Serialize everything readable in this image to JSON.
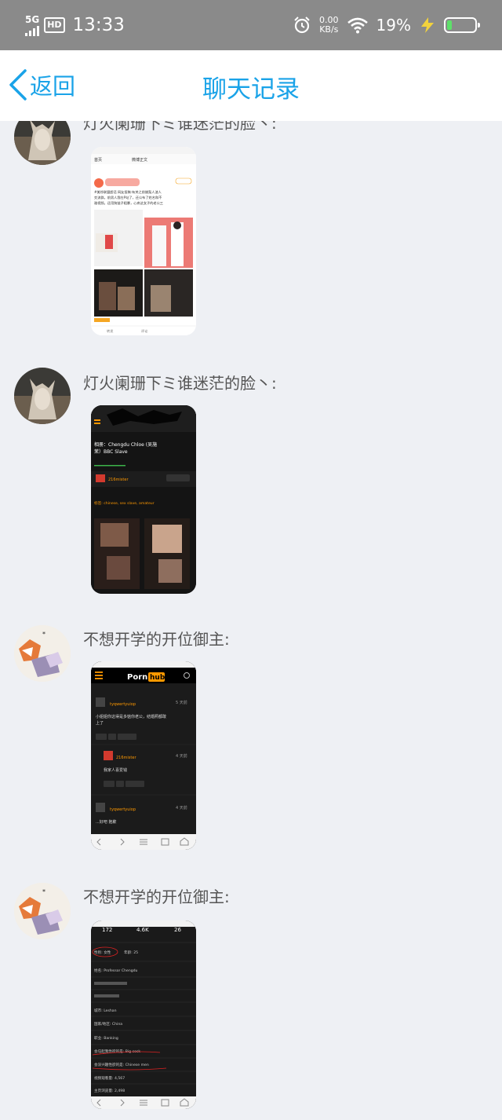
{
  "status_bar": {
    "network": "5G",
    "hd": "HD",
    "time": "13:33",
    "speed_value": "0.00",
    "speed_unit": "KB/s",
    "battery_percent": "19%",
    "battery_level": 0.19
  },
  "header": {
    "back_label": "返回",
    "title": "聊天记录"
  },
  "messages": [
    {
      "sender": "灯火阑珊下ミ谁迷茫的脸丶:",
      "image": {
        "nav_back": "首页",
        "nav_title": "微博正文",
        "post_text_1": "#美徐联盟超话 网友投稿:有关之前腊梨人渣人",
        "post_text_2": "交流群。前男人我在P站了，还公布了姓名和不",
        "post_text_3": "雅视频。还用狗链子粗暴，心疼这女子的老公三",
        "action_forward": "转发",
        "action_comment": "评论"
      }
    },
    {
      "sender": "灯火阑珊下ミ谁迷茫的脸丶:",
      "image": {
        "album_title": "相册：Chengdu Chloe (吴施",
        "album_title_2": "茉）BBC Slave",
        "user": "216mister",
        "tags": "标签: chinese, sex slave, amateur"
      }
    },
    {
      "sender": "不想开学的开位御主:",
      "image": {
        "logo_a": "Porn",
        "logo_b": "hub",
        "c1_user": "tyqwertyuiop",
        "c1_time": "5 天前",
        "c1_text_1": "小姐姐你这得是多惦你老公，结婚照都敢",
        "c1_text_2": "上了",
        "c2_user": "216mister",
        "c2_time": "4 天前",
        "c2_text": "我家人喜爱钱",
        "c3_user": "tyqwertyuiop",
        "c3_time": "4 天前",
        "c3_text": "...好吧 抱歉"
      }
    },
    {
      "sender": "不想开学的开位御主:",
      "image": {
        "stat1": "172",
        "stat2": "4.6K",
        "stat3": "26",
        "row_gender": "性别: 女性",
        "row_age": "年龄: 25",
        "row_name": "姓名: Professor Chengdu",
        "row_city": "城市: Leshan",
        "row_country": "国家/地区: China",
        "row_job": "职业: Banking",
        "row_turn_on": "会勾起我性欲的是: Big cock",
        "row_turn_off": "会没兴趣性欲的是: Chinese men",
        "row_views": "视频观看量: 4,567",
        "row_profile_views": "主页浏览量: 2,498"
      }
    }
  ]
}
